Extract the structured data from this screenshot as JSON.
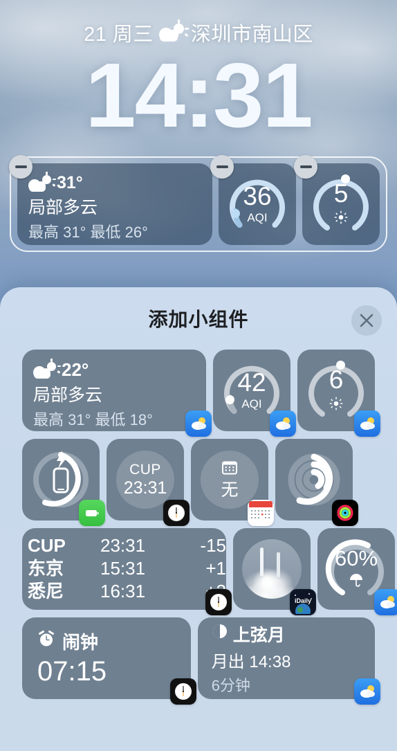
{
  "lockscreen": {
    "date": "21 周三",
    "location": "深圳市南山区",
    "weather_icon": "sun-behind-cloud-icon",
    "time": "14:31"
  },
  "active_widgets": {
    "remove_label": "−",
    "items": [
      {
        "type": "weather-summary",
        "name": "active-widget-weather",
        "temp": "31°",
        "condition": "局部多云",
        "range": "最高 31° 最低 26°",
        "icon": "sun-behind-cloud-icon"
      },
      {
        "type": "gauge",
        "name": "active-widget-aqi",
        "value": "36",
        "label": "AQI",
        "icon": "air-quality-gauge-icon"
      },
      {
        "type": "gauge",
        "name": "active-widget-uv",
        "value": "5",
        "label": "",
        "icon": "sun-uv-icon"
      }
    ]
  },
  "sheet": {
    "title": "添加小组件",
    "close_icon": "close-icon",
    "gallery_rows": [
      [
        {
          "kind": "weather-summary",
          "name": "gallery-widget-weather",
          "size": "wide",
          "temp": "22°",
          "condition": "局部多云",
          "range": "最高 31° 最低 18°",
          "icon": "sun-behind-cloud-icon",
          "badge": "weather-app-icon"
        },
        {
          "kind": "gauge",
          "name": "gallery-widget-aqi",
          "size": "sq",
          "value": "42",
          "label": "AQI",
          "badge": "weather-app-icon"
        },
        {
          "kind": "gauge-uv",
          "name": "gallery-widget-uv",
          "size": "sq",
          "value": "6",
          "label": "",
          "icon": "sun-uv-icon",
          "badge": "weather-app-icon"
        }
      ],
      [
        {
          "kind": "battery-ring",
          "name": "gallery-widget-battery",
          "size": "sq",
          "icon": "iphone-charging-icon",
          "badge": "batteries-app-icon"
        },
        {
          "kind": "city-clock",
          "name": "gallery-widget-city-clock",
          "size": "sq",
          "city": "CUP",
          "time": "23:31",
          "badge": "clock-app-icon"
        },
        {
          "kind": "calendar-empty",
          "name": "gallery-widget-calendar",
          "size": "sq",
          "icon": "calendar-icon",
          "value": "无",
          "badge": "calendar-app-icon"
        },
        {
          "kind": "activity-rings",
          "name": "gallery-widget-fitness",
          "size": "sq",
          "icon": "activity-rings-icon",
          "badge": "fitness-app-icon"
        }
      ],
      [
        {
          "kind": "world-clock-list",
          "name": "gallery-widget-world-clock",
          "size": "wide",
          "rows": [
            {
              "city": "CUP",
              "time": "23:31",
              "offset": "-15"
            },
            {
              "city": "东京",
              "time": "15:31",
              "offset": "+1"
            },
            {
              "city": "悉尼",
              "time": "16:31",
              "offset": "+2"
            }
          ],
          "badge": "clock-app-icon"
        },
        {
          "kind": "photo",
          "name": "gallery-widget-idaily",
          "size": "sq",
          "badge": "idaily-app-icon",
          "badge_label": "iDaily"
        },
        {
          "kind": "gauge-rain",
          "name": "gallery-widget-rain",
          "size": "sq",
          "value": "60%",
          "icon": "umbrella-icon",
          "badge": "weather-app-icon"
        }
      ],
      [
        {
          "kind": "alarm",
          "name": "gallery-widget-alarm",
          "size": "wide",
          "icon": "alarm-clock-icon",
          "title": "闹钟",
          "time": "07:15",
          "badge": "clock-app-icon"
        },
        {
          "kind": "moon",
          "name": "gallery-widget-moon",
          "size": "wide",
          "icon": "moon-phase-icon",
          "phase": "上弦月",
          "rise": "月出 14:38",
          "duration": "6分钟",
          "badge": "weather-app-icon"
        }
      ]
    ]
  },
  "colors": {
    "widget_fill": "#6f8091",
    "active_widget_fill": "#263a52",
    "sheet_bg": "#ccdcee",
    "accent_white": "#ffffff",
    "weather_badge": "#2f8ff0",
    "battery_badge": "#42c74c"
  }
}
